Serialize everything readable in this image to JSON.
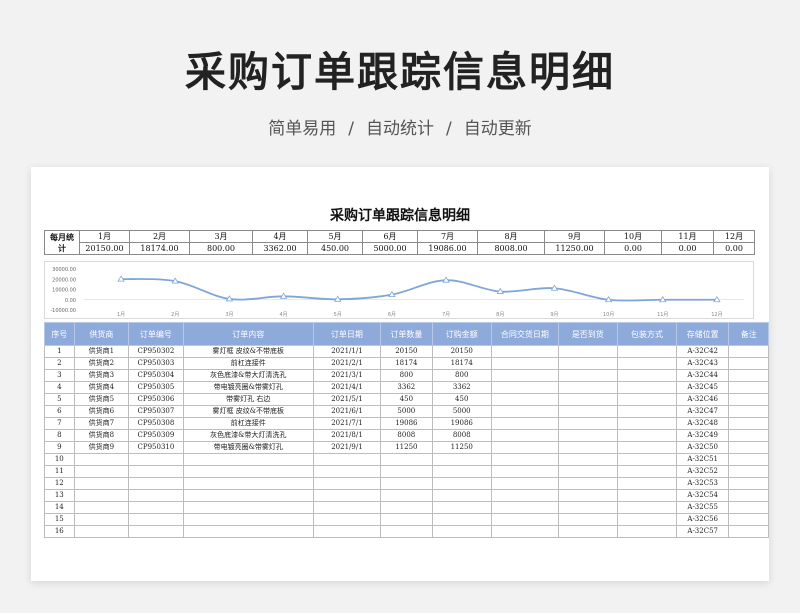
{
  "banner": {
    "title": "采购订单跟踪信息明细",
    "subtitle": [
      "简单易用",
      "自动统计",
      "自动更新"
    ],
    "separator": "/"
  },
  "sheet_title": "采购订单跟踪信息明细",
  "monthly": {
    "label": "每月统计",
    "months": [
      "1月",
      "2月",
      "3月",
      "4月",
      "5月",
      "6月",
      "7月",
      "8月",
      "9月",
      "10月",
      "11月",
      "12月"
    ],
    "values": [
      "20150.00",
      "18174.00",
      "800.00",
      "3362.00",
      "450.00",
      "5000.00",
      "19086.00",
      "8008.00",
      "11250.00",
      "0.00",
      "0.00",
      "0.00"
    ]
  },
  "chart_data": {
    "type": "line",
    "categories": [
      "1月",
      "2月",
      "3月",
      "4月",
      "5月",
      "6月",
      "7月",
      "8月",
      "9月",
      "10月",
      "11月",
      "12月"
    ],
    "series": [
      {
        "values": [
          20150,
          18174,
          800,
          3362,
          450,
          5000,
          19086,
          8008,
          11250,
          0,
          0,
          0
        ]
      }
    ],
    "y_ticks": [
      "30000.00",
      "20000.00",
      "10000.00",
      "0.00",
      "-10000.00"
    ],
    "ylim": [
      -10000,
      30000
    ],
    "line_color": "#7ea6d8",
    "grid": false
  },
  "table": {
    "headers": [
      "序号",
      "供货商",
      "订单编号",
      "订单内容",
      "订单日期",
      "订单数量",
      "订购金额",
      "合同交货日期",
      "是否到货",
      "包装方式",
      "存储位置",
      "备注"
    ],
    "rows": [
      [
        "1",
        "供货商1",
        "CP950302",
        "雾灯框 皮纹&不带底板",
        "2021/1/1",
        "20150",
        "20150",
        "",
        "",
        "",
        "A-32C42",
        ""
      ],
      [
        "2",
        "供货商2",
        "CP950303",
        "前杠连接件",
        "2021/2/1",
        "18174",
        "18174",
        "",
        "",
        "",
        "A-32C43",
        ""
      ],
      [
        "3",
        "供货商3",
        "CP950304",
        "灰色底漆&带大灯清洗孔",
        "2021/3/1",
        "800",
        "800",
        "",
        "",
        "",
        "A-32C44",
        ""
      ],
      [
        "4",
        "供货商4",
        "CP950305",
        "带电镀亮圈&带雾灯孔",
        "2021/4/1",
        "3362",
        "3362",
        "",
        "",
        "",
        "A-32C45",
        ""
      ],
      [
        "5",
        "供货商5",
        "CP950306",
        "带雾灯孔 右边",
        "2021/5/1",
        "450",
        "450",
        "",
        "",
        "",
        "A-32C46",
        ""
      ],
      [
        "6",
        "供货商6",
        "CP950307",
        "雾灯框 皮纹&不带底板",
        "2021/6/1",
        "5000",
        "5000",
        "",
        "",
        "",
        "A-32C47",
        ""
      ],
      [
        "7",
        "供货商7",
        "CP950308",
        "前杠连接件",
        "2021/7/1",
        "19086",
        "19086",
        "",
        "",
        "",
        "A-32C48",
        ""
      ],
      [
        "8",
        "供货商8",
        "CP950309",
        "灰色底漆&带大灯清洗孔",
        "2021/8/1",
        "8008",
        "8008",
        "",
        "",
        "",
        "A-32C49",
        ""
      ],
      [
        "9",
        "供货商9",
        "CP950310",
        "带电镀亮圈&带雾灯孔",
        "2021/9/1",
        "11250",
        "11250",
        "",
        "",
        "",
        "A-32C50",
        ""
      ],
      [
        "10",
        "",
        "",
        "",
        "",
        "",
        "",
        "",
        "",
        "",
        "A-32C51",
        ""
      ],
      [
        "11",
        "",
        "",
        "",
        "",
        "",
        "",
        "",
        "",
        "",
        "A-32C52",
        ""
      ],
      [
        "12",
        "",
        "",
        "",
        "",
        "",
        "",
        "",
        "",
        "",
        "A-32C53",
        ""
      ],
      [
        "13",
        "",
        "",
        "",
        "",
        "",
        "",
        "",
        "",
        "",
        "A-32C54",
        ""
      ],
      [
        "14",
        "",
        "",
        "",
        "",
        "",
        "",
        "",
        "",
        "",
        "A-32C55",
        ""
      ],
      [
        "15",
        "",
        "",
        "",
        "",
        "",
        "",
        "",
        "",
        "",
        "A-32C56",
        ""
      ],
      [
        "16",
        "",
        "",
        "",
        "",
        "",
        "",
        "",
        "",
        "",
        "A-32C57",
        ""
      ]
    ]
  }
}
